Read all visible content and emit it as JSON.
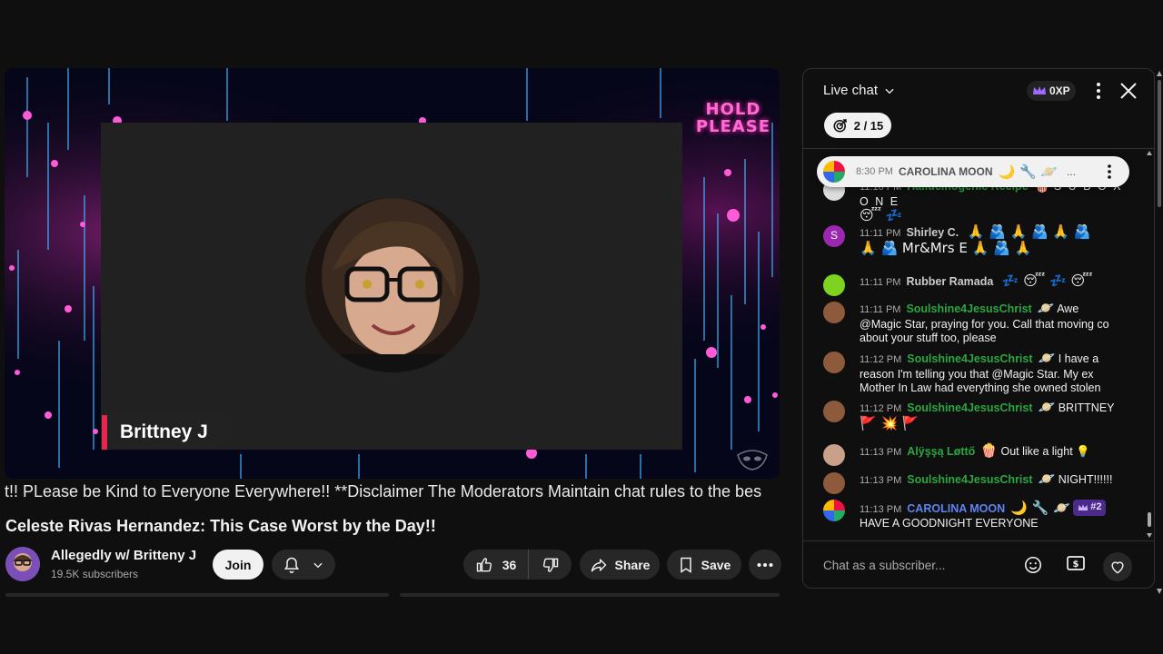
{
  "video": {
    "hold_please_line1": "HOLD",
    "hold_please_line2": "PLEASE",
    "name_tag": "Brittney J",
    "ticker": "t!! PLease be Kind to Everyone Everywhere!! **Disclaimer The Moderators Maintain chat rules to the bes",
    "title": "Celeste Rivas Hernandez: This Case Worst by the Day!!"
  },
  "channel": {
    "name": "Allegedly w/ Britteny J",
    "subscribers": "19.5K subscribers",
    "join_label": "Join"
  },
  "actions": {
    "like_count": "36",
    "share_label": "Share",
    "save_label": "Save"
  },
  "chat": {
    "title": "Live chat",
    "xp_label": "0XP",
    "goal_progress": "2 / 15",
    "pinned": {
      "time": "8:30 PM",
      "author": "CAROLINA MOON",
      "emojis": "🌙 🔧 🪐",
      "ellipsis": "..."
    },
    "messages": [
      {
        "time": "11:10 PM",
        "author": "Hallucinogenic Recipe",
        "author_badge": "🍿",
        "text": "S U B O X O N E",
        "line2": "😴 💤"
      },
      {
        "time": "11:11 PM",
        "author": "Shirley C.",
        "text": "🙏 🫂 🙏 🫂 🙏 🫂",
        "line2": "🙏 🫂 Mr&Mrs E 🙏 🫂 🙏"
      },
      {
        "time": "11:11 PM",
        "author": "Rubber Ramada",
        "text": "💤 😴 💤 😴"
      },
      {
        "time": "11:11 PM",
        "author": "Soulshine4JesusChrist",
        "author_badge": "🪐",
        "text": "Awe @Magic Star, praying for you. Call that moving co about your stuff too, please"
      },
      {
        "time": "11:12 PM",
        "author": "Soulshine4JesusChrist",
        "author_badge": "🪐",
        "text": "I have a reason I'm telling you that @Magic Star. My ex Mother In Law had everything she owned stolen"
      },
      {
        "time": "11:12 PM",
        "author": "Soulshine4JesusChrist",
        "author_badge": "🪐",
        "text": "BRITTNEY",
        "line2": "🚩 💥 🚩"
      },
      {
        "time": "11:13 PM",
        "author": "Alÿşşą Løttő",
        "author_badge": "🍿",
        "text": "Out like a light 💡"
      },
      {
        "time": "11:13 PM",
        "author": "Soulshine4JesusChrist",
        "author_badge": "🪐",
        "text": "NIGHT!!!!!!"
      },
      {
        "time": "11:13 PM",
        "author": "CAROLINA MOON",
        "author_badge": "🌙 🔧 🪐",
        "rank": "#2",
        "text": "HAVE A GOODNIGHT EVERYONE"
      }
    ],
    "input_placeholder": "Chat as a subscriber..."
  },
  "colors": {
    "accent_red": "#e8264b",
    "author_green": "#2ba640",
    "author_blue": "#5e84f1",
    "neon_pink": "#ff6ad5"
  }
}
